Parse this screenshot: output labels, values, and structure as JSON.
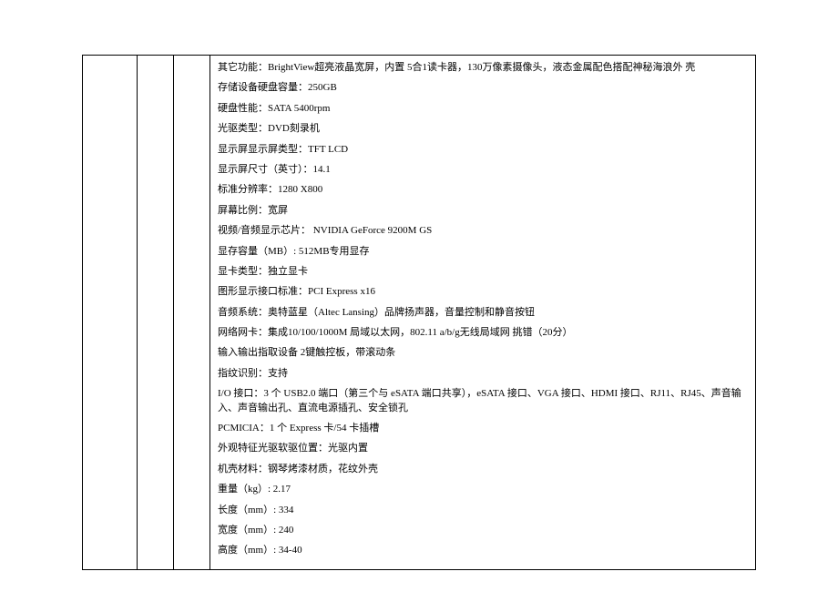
{
  "specs": {
    "lines": [
      "其它功能：BrightView超亮液晶宽屏，内置 5合1读卡器，130万像素摄像头，液态金属配色搭配神秘海浪外  壳",
      "存储设备硬盘容量：250GB",
      "硬盘性能：SATA 5400rpm",
      "光驱类型：DVD刻录机",
      "显示屏显示屏类型：TFT LCD",
      "显示屏尺寸（英寸）：14.1",
      "标准分辨率：1280 X800",
      "屏幕比例：宽屏",
      "视频/音频显示芯片：   NVIDIA GeForce 9200M GS",
      "显存容量（MB）: 512MB专用显存",
      "显卡类型：独立显卡",
      "图形显示接口标准：PCI Express x16",
      "音频系统：奥特蓝星（Altec Lansing）品牌扬声器，音量控制和静音按钮",
      "网络网卡：集成10/100/1000M 局域以太网，802.11 a/b/g无线局域网  挑错（20分）",
      "输入输出指取设备  2键触控板，带滚动条",
      "指纹识别：支持",
      "I/O 接口：3 个 USB2.0 端口（第三个与 eSATA 端口共享），eSATA 接口、VGA 接口、HDMI 接口、RJ11、RJ45、声音输入、声音输出孔、直流电源插孔、安全锁孔",
      "PCMICIA：1 个  Express 卡/54 卡插槽",
      "外观特征光驱软驱位置：光驱内置",
      "机壳材料：钢琴烤漆材质，花纹外壳",
      "重量（kg）: 2.17",
      "长度（mm）: 334",
      "宽度（mm）: 240",
      "高度（mm）: 34-40"
    ]
  }
}
